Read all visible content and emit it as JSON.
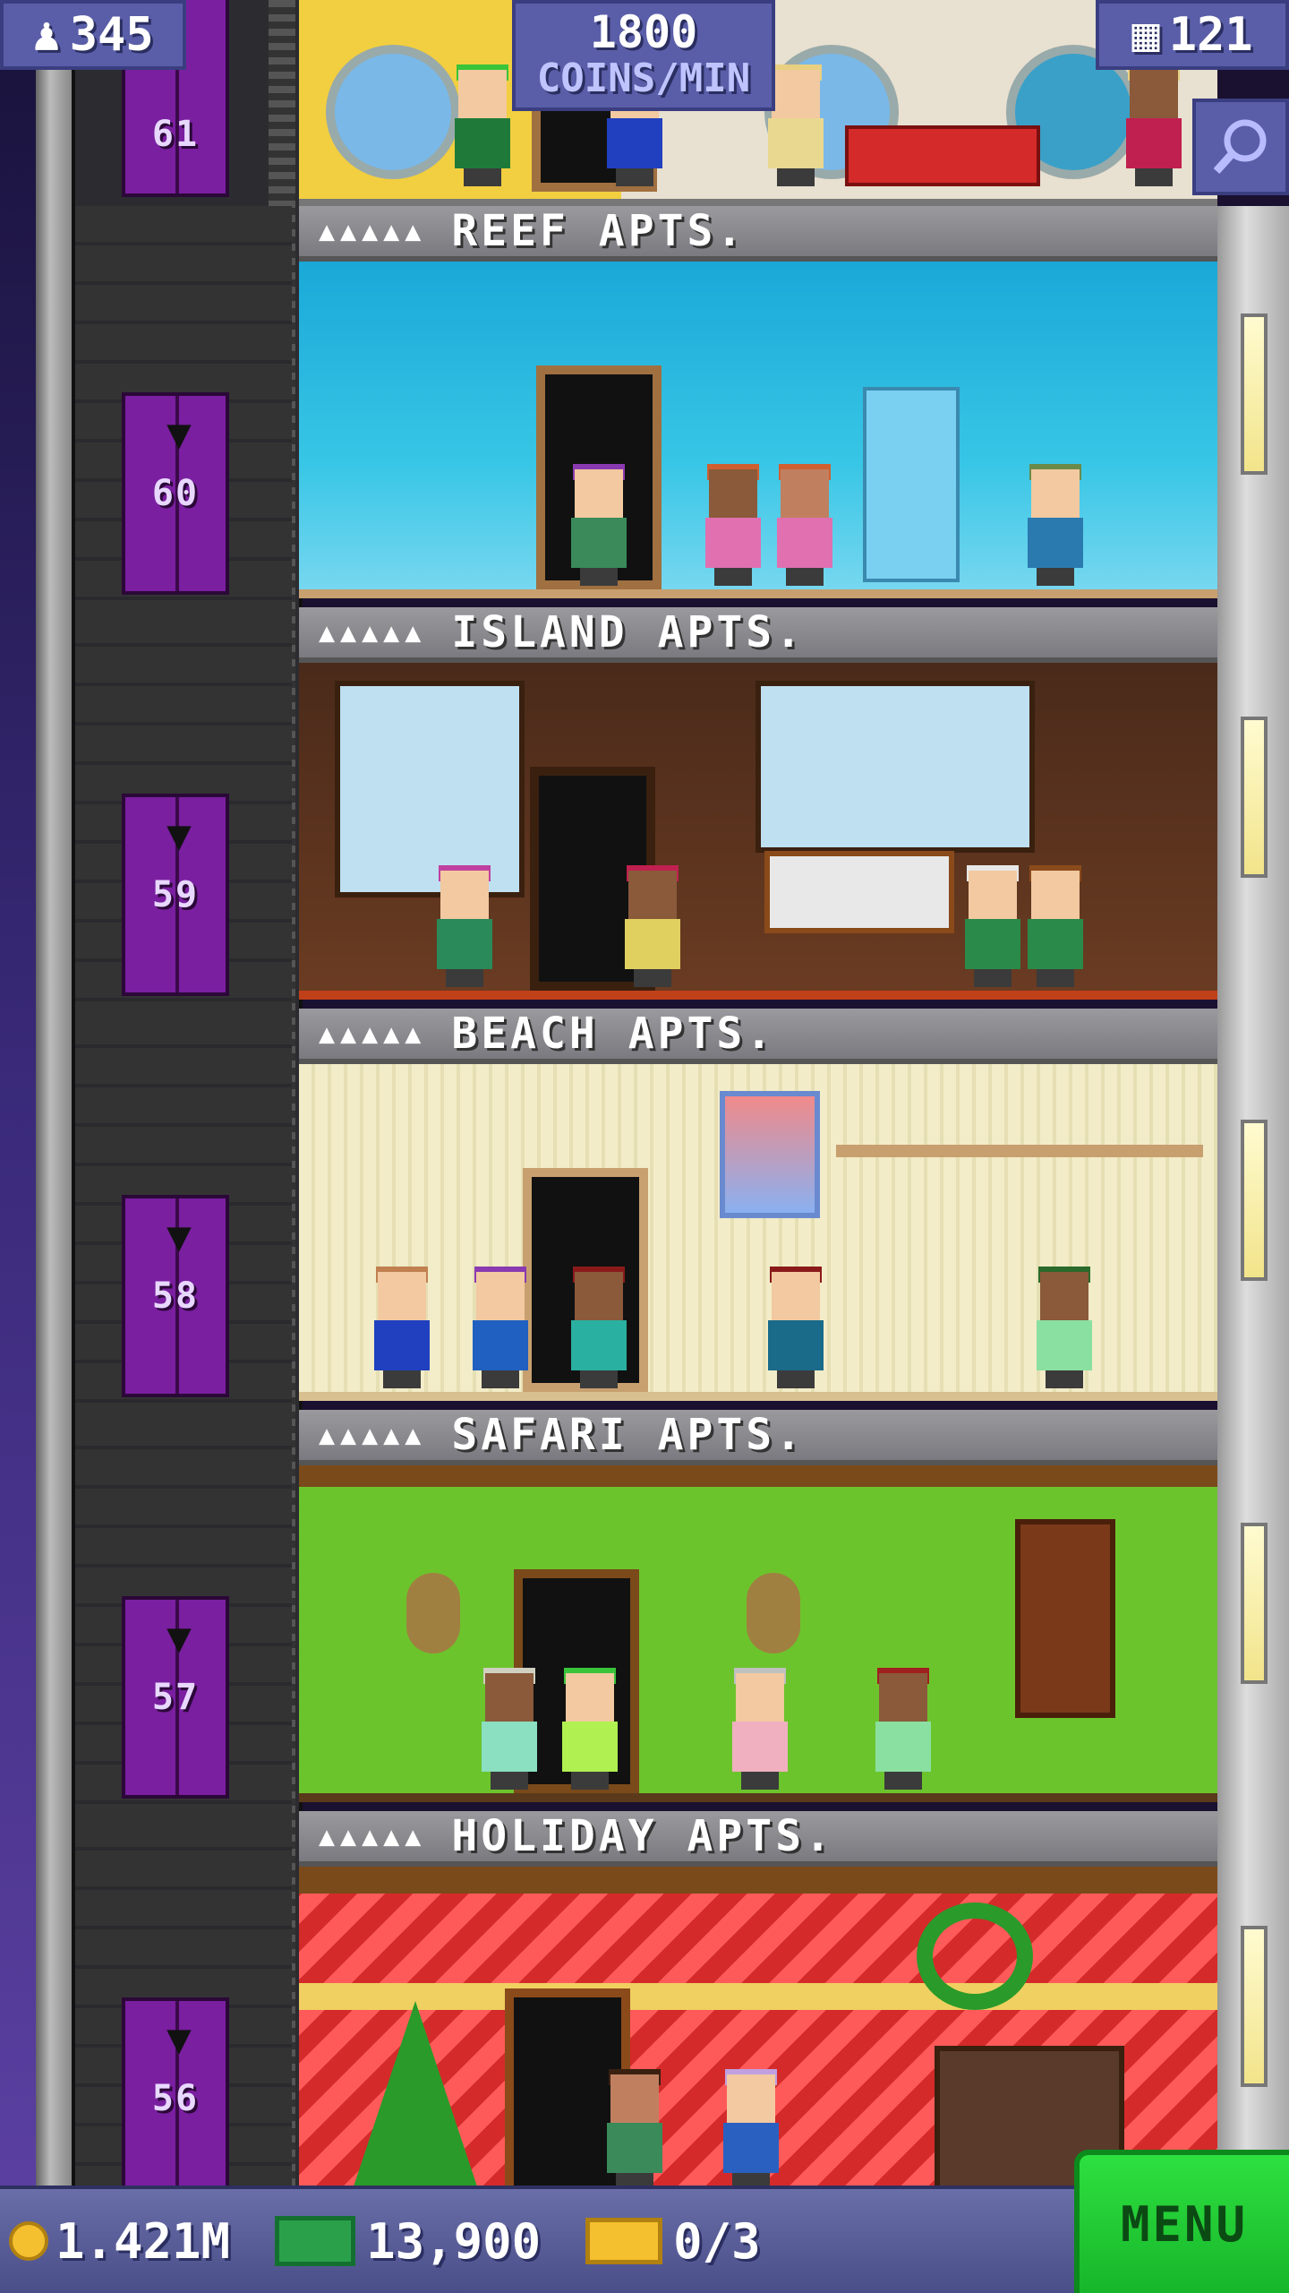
{
  "hud": {
    "population": "345",
    "coins_rate_value": "1800",
    "coins_rate_unit": "COINS/MIN",
    "floor_count": "121"
  },
  "top_floor": {
    "number": "61"
  },
  "floors": [
    {
      "number": "60",
      "name": "REEF APTS.",
      "residents": "▲▲▲▲▲"
    },
    {
      "number": "59",
      "name": "ISLAND APTS.",
      "residents": "▲▲▲▲▲"
    },
    {
      "number": "58",
      "name": "BEACH APTS.",
      "residents": "▲▲▲▲▲"
    },
    {
      "number": "57",
      "name": "SAFARI APTS.",
      "residents": "▲▲▲▲▲"
    },
    {
      "number": "56",
      "name": "HOLIDAY APTS.",
      "residents": "▲▲▲▲▲"
    }
  ],
  "bottom_bar": {
    "coins": "1.421M",
    "bux": "13,900",
    "tickets": "0/3",
    "menu_label": "MENU"
  },
  "icons": {
    "population": "person-icon",
    "floors": "building-icon",
    "search": "magnifier-icon",
    "coins": "coin-icon",
    "bux": "bux-icon",
    "tickets": "ticket-icon",
    "elevator_decoration": "bat-icon"
  },
  "colors": {
    "hud": "#5a5ea8",
    "elevator": "#7a1fa0",
    "menu_button": "#2ee040",
    "coin": "#f5c030",
    "bux": "#2aa04a"
  }
}
